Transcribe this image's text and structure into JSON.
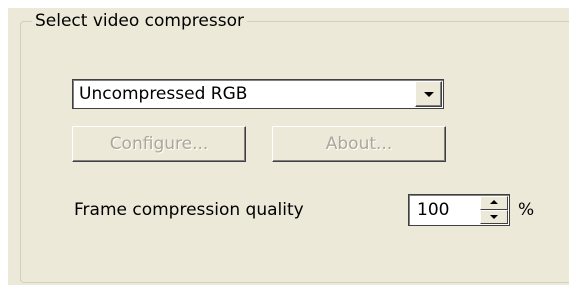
{
  "group": {
    "title": "Select video compressor"
  },
  "compressor": {
    "selected": "Uncompressed RGB"
  },
  "buttons": {
    "configure": "Configure...",
    "about": "About..."
  },
  "quality": {
    "label": "Frame compression quality",
    "value": "100",
    "unit": "%"
  },
  "icons": {
    "combo_arrow": "chevron-down-icon",
    "spin_up": "arrow-up-icon",
    "spin_down": "arrow-down-icon"
  },
  "colors": {
    "dialog_background": "#ECE9D8",
    "disabled_text": "#ACA899",
    "groupbox_border": "#D0D0BF"
  }
}
